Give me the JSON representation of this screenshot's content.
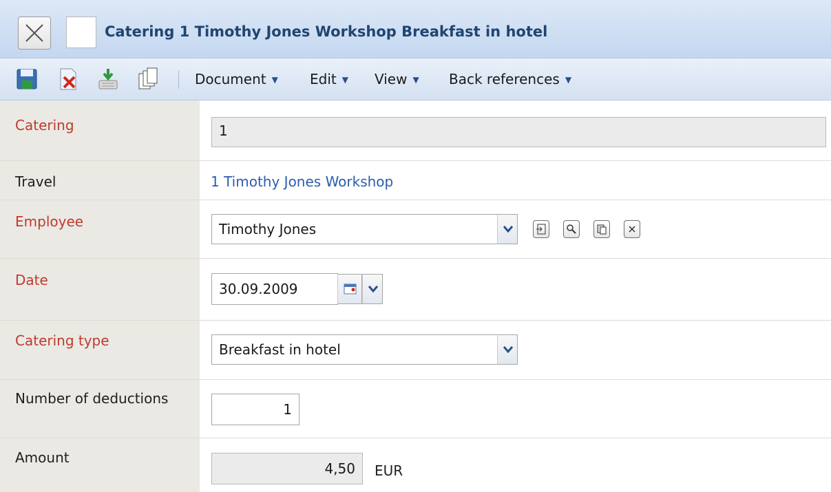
{
  "window": {
    "title": "Catering 1 Timothy Jones Workshop Breakfast in hotel"
  },
  "toolbar": {
    "icons": [
      "save-icon",
      "delete-icon",
      "export-icon",
      "copy-icon"
    ],
    "menus": {
      "document": "Document",
      "edit": "Edit",
      "view": "View",
      "back_references": "Back references"
    }
  },
  "form": {
    "catering": {
      "label": "Catering",
      "value": "1"
    },
    "travel": {
      "label": "Travel",
      "value": "1 Timothy Jones Workshop"
    },
    "employee": {
      "label": "Employee",
      "value": "Timothy Jones"
    },
    "date": {
      "label": "Date",
      "value": "30.09.2009"
    },
    "catering_type": {
      "label": "Catering type",
      "value": "Breakfast in hotel"
    },
    "deductions": {
      "label": "Number of deductions",
      "value": "1"
    },
    "amount": {
      "label": "Amount",
      "value": "4,50",
      "currency": "EUR"
    }
  },
  "colors": {
    "required_label": "#c03a2f",
    "link": "#2a5db0",
    "title_text": "#21456f"
  }
}
